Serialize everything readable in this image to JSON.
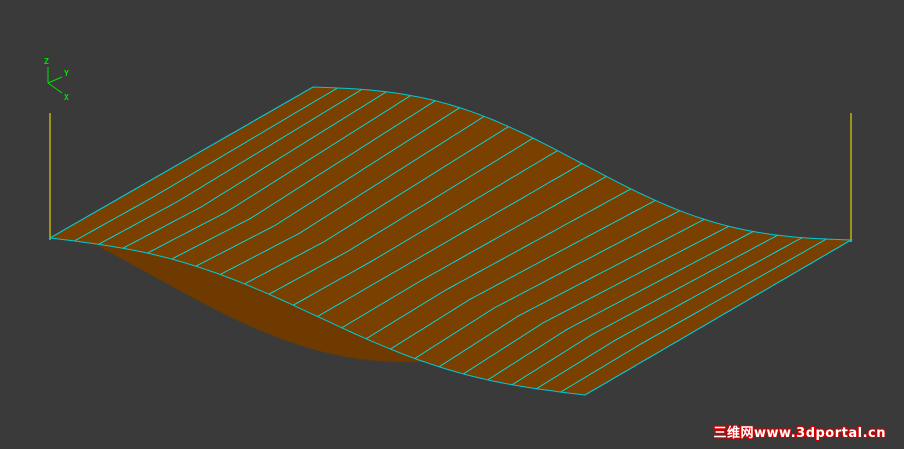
{
  "viewport": {
    "background_color": "#3a3a3a",
    "surface_color": "#7a4000",
    "surface_edge_color": "#00c8d8",
    "wireline_color": "#00e0f0",
    "post_color": "#e0d000",
    "wireline_count": 22
  },
  "axis_gizmo": {
    "z_label": "Z",
    "y_label": "Y",
    "x_label": "X",
    "color": "#00e000",
    "z_color": "#00e000",
    "x_color": "#00c0ff"
  },
  "watermark": {
    "text": "三维网www.3dportal.cn"
  }
}
